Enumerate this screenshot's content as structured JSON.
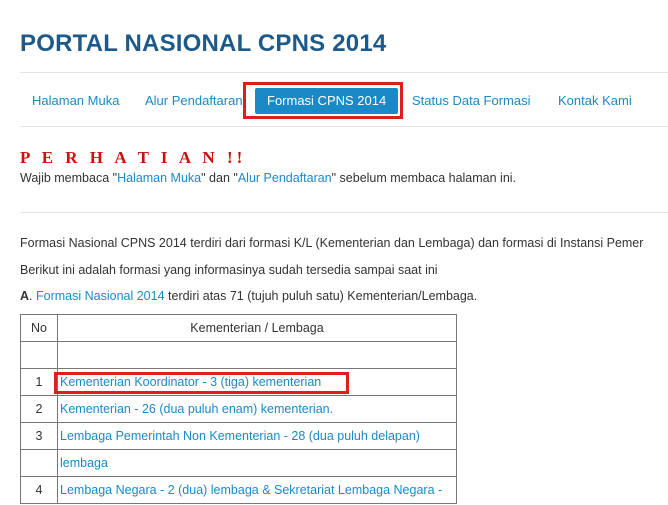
{
  "site": {
    "title": "PORTAL NASIONAL CPNS 2014"
  },
  "nav": [
    {
      "label": "Halaman Muka",
      "active": false
    },
    {
      "label": "Alur Pendaftaran",
      "active": false
    },
    {
      "label": "Formasi CPNS 2014",
      "active": true
    },
    {
      "label": "Status Data Formasi",
      "active": false
    },
    {
      "label": "Kontak Kami",
      "active": false
    }
  ],
  "notice": {
    "heading": "P E R H A T I A N !!",
    "pre": "Wajib membaca \"",
    "link1": "Halaman Muka",
    "mid": "\" dan \"",
    "link2": "Alur Pendaftaran",
    "post": "\" sebelum membaca halaman ini."
  },
  "content": {
    "intro1": "Formasi Nasional CPNS 2014 terdiri dari formasi K/L (Kementerian dan Lembaga) dan formasi di Instansi Pemer",
    "intro2": "Berikut ini adalah formasi yang informasinya sudah tersedia sampai saat ini",
    "section_a": {
      "letter": "A",
      "dot": ".",
      "link": "Formasi Nasional 2014",
      "rest": " terdiri atas 71 (tujuh puluh satu) Kementerian/Lembaga."
    }
  },
  "table": {
    "headers": {
      "no": "No",
      "name": "Kementerian / Lembaga"
    },
    "rows": [
      {
        "no": "1",
        "name": "Kementerian Koordinator - 3 (tiga) kementerian"
      },
      {
        "no": "2",
        "name": "Kementerian - 26 (dua puluh enam) kementerian."
      },
      {
        "no": "3",
        "name": "Lembaga Pemerintah Non Kementerian - 28 (dua puluh delapan)"
      },
      {
        "no": "",
        "name": "lembaga"
      },
      {
        "no": "4",
        "name": "Lembaga Negara - 2 (dua) lembaga & Sekretariat Lembaga Negara -"
      }
    ]
  },
  "colors": {
    "accent": "#1a8ac6",
    "title": "#1d5a8a",
    "warning": "#cc1010",
    "highlight": "#dd1f1f"
  }
}
